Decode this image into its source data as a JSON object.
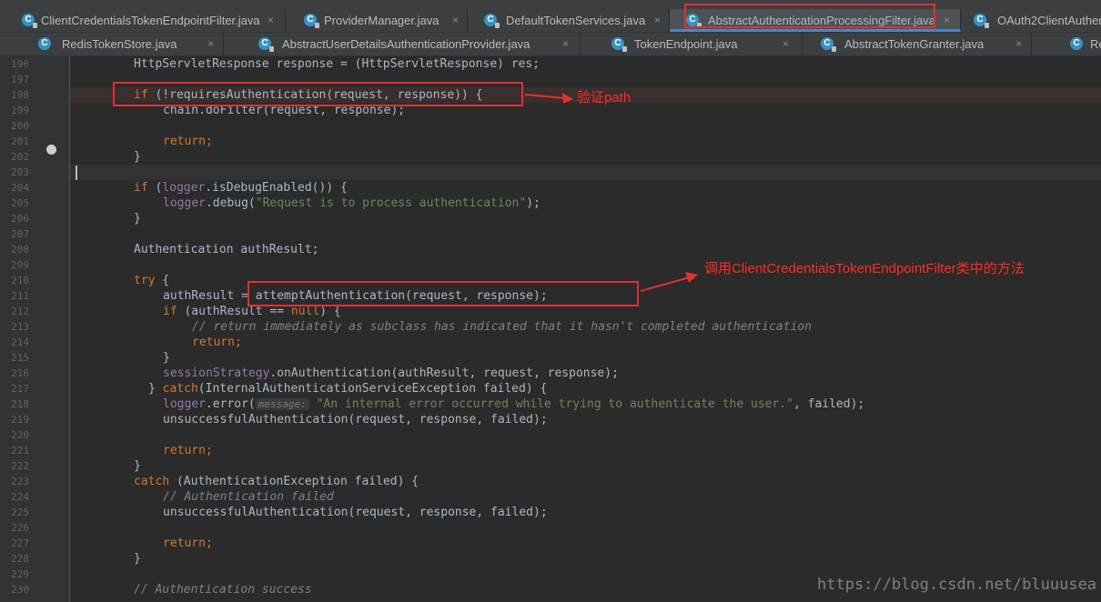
{
  "tabs_row1": [
    {
      "label": "ClientCredentialsTokenEndpointFilter.java",
      "icon": "C",
      "lock": true,
      "active": false
    },
    {
      "label": "ProviderManager.java",
      "icon": "C",
      "lock": true,
      "active": false
    },
    {
      "label": "DefaultTokenServices.java",
      "icon": "C",
      "lock": true,
      "active": false
    },
    {
      "label": "AbstractAuthenticationProcessingFilter.java",
      "icon": "C",
      "lock": true,
      "active": true
    },
    {
      "label": "OAuth2ClientAuthen",
      "icon": "C",
      "lock": true,
      "active": false
    }
  ],
  "tabs_row2": [
    {
      "label": "RedisTokenStore.java",
      "icon": "C",
      "lock": false,
      "active": false
    },
    {
      "label": "AbstractUserDetailsAuthenticationProvider.java",
      "icon": "C",
      "lock": true,
      "active": false
    },
    {
      "label": "TokenEndpoint.java",
      "icon": "C",
      "lock": true,
      "active": false
    },
    {
      "label": "AbstractTokenGranter.java",
      "icon": "C",
      "lock": true,
      "active": false
    },
    {
      "label": "Re",
      "icon": "C",
      "lock": false,
      "active": false
    }
  ],
  "close_glyph": "×",
  "line_numbers": [
    "196",
    "197",
    "198",
    "199",
    "200",
    "201",
    "202",
    "203",
    "204",
    "205",
    "206",
    "207",
    "208",
    "209",
    "210",
    "211",
    "212",
    "213",
    "214",
    "215",
    "216",
    "217",
    "218",
    "219",
    "220",
    "221",
    "222",
    "223",
    "224",
    "225",
    "226",
    "227",
    "228",
    "229",
    "230"
  ],
  "code": {
    "l196_a": "HttpServletResponse response = (HttpServletResponse) res;",
    "l198_kw": "if",
    "l198_rest": " (!requiresAuthentication(request, response)) {",
    "l199": "chain.doFilter(request, response);",
    "l201_kw": "return",
    "l201_rest": ";",
    "l202": "}",
    "l204_kw": "if",
    "l204_a": " (",
    "l204_f": "logger",
    "l204_b": ".isDebugEnabled()) {",
    "l205_f": "logger",
    "l205_a": ".debug(",
    "l205_s": "\"Request is to process authentication\"",
    "l205_b": ");",
    "l206": "}",
    "l208": "Authentication authResult;",
    "l210_kw": "try",
    "l210_rest": " {",
    "l211": "authResult = attemptAuthentication(request, response);",
    "l212_a": "if",
    "l212_b": " (authResult == ",
    "l212_kw": "null",
    "l212_c": ") {",
    "l213": "// return immediately as subclass has indicated that it hasn't completed authentication",
    "l214_kw": "return",
    "l214_rest": ";",
    "l215": "}",
    "l216_f": "sessionStrategy",
    "l216_rest": ".onAuthentication(authResult, request, response);",
    "l217_a": "} ",
    "l217_kw": "catch",
    "l217_rest": "(InternalAuthenticationServiceException failed) {",
    "l218_f": "logger",
    "l218_a": ".error(",
    "l218_hint": "message:",
    "l218_s": "\"An internal error occurred while trying to authenticate the user.\"",
    "l218_b": ", failed);",
    "l219": "unsuccessfulAuthentication(request, response, failed);",
    "l221_kw": "return",
    "l221_rest": ";",
    "l222": "}",
    "l223_kw": "catch",
    "l223_rest": " (AuthenticationException failed) {",
    "l224": "// Authentication failed",
    "l225": "unsuccessfulAuthentication(request, response, failed);",
    "l227_kw": "return",
    "l227_rest": ";",
    "l228": "}",
    "l230": "// Authentication success"
  },
  "annotations": {
    "path_note": "验证path",
    "method_note": "调用ClientCredentialsTokenEndpointFilter类中的方法",
    "color": "#e03030"
  },
  "watermark": "https://blog.csdn.net/bluuusea"
}
